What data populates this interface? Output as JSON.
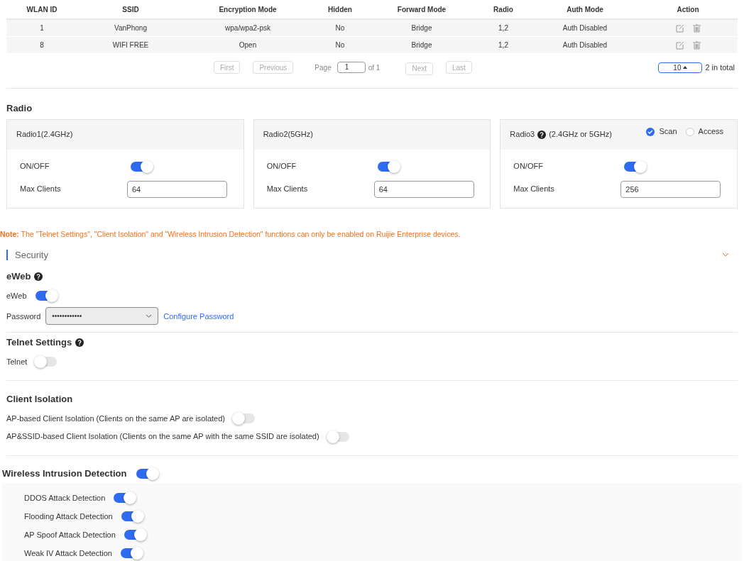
{
  "wlan_table": {
    "columns": [
      "WLAN ID",
      "SSID",
      "Encryption Mode",
      "Hidden",
      "Forward Mode",
      "Radio",
      "Auth Mode",
      "Action"
    ],
    "rows": [
      [
        "1",
        "VanPhong",
        "wpa/wpa2-psk",
        "No",
        "Bridge",
        "1,2",
        "Auth Disabled"
      ],
      [
        "8",
        "WIFI FREE",
        "Open",
        "No",
        "Bridge",
        "1,2",
        "Auth Disabled"
      ]
    ]
  },
  "pagination": {
    "first": "First",
    "previous": "Previous",
    "page_label": "Page",
    "page": "1",
    "of": "of 1",
    "next": "Next",
    "last": "Last",
    "page_size": "10",
    "total": "2 in total"
  },
  "radio": {
    "title": "Radio",
    "cards": [
      {
        "name": "Radio1(2.4GHz)",
        "help": false,
        "onoff_label": "ON/OFF",
        "on": true,
        "max_label": "Max Clients",
        "max_clients": "64"
      },
      {
        "name": "Radio2(5GHz)",
        "help": false,
        "onoff_label": "ON/OFF",
        "on": true,
        "max_label": "Max Clients",
        "max_clients": "64"
      },
      {
        "name": "Radio3",
        "help": true,
        "band": "(2.4GHz or 5GHz)",
        "modes": [
          {
            "label": "Scan",
            "selected": true
          },
          {
            "label": "Access",
            "selected": false
          }
        ],
        "onoff_label": "ON/OFF",
        "on": true,
        "max_label": "Max Clients",
        "max_clients": "256"
      }
    ]
  },
  "note": {
    "prefix": "Note:",
    "text": " The \"Telnet Settings\", \"Client Isolation\" and \"Wireless Intrusion Detection\" functions can only be enabled on Ruijie Enterprise devices."
  },
  "security": {
    "title": "Security",
    "expanded": true
  },
  "eweb": {
    "title": "eWeb",
    "toggle_label": "eWeb",
    "on": true,
    "password_label": "Password",
    "password": "••••••••••••",
    "configure_link": "Configure Password"
  },
  "telnet": {
    "title": "Telnet Settings",
    "toggle_label": "Telnet",
    "on": false
  },
  "client_isolation": {
    "title": "Client Isolation",
    "items": [
      {
        "label": "AP-based Client Isolation (Clients on the same AP are isolated)",
        "on": false
      },
      {
        "label": "AP&SSID-based Client Isolation (Clients on the same AP with the same SSID are isolated)",
        "on": false
      }
    ]
  },
  "wids": {
    "title": "Wireless Intrusion Detection",
    "on": true,
    "items": [
      {
        "label": "DDOS Attack Detection",
        "on": true
      },
      {
        "label": "Flooding Attack Detection",
        "on": true
      },
      {
        "label": "AP Spoof Attack Detection",
        "on": true
      },
      {
        "label": "Weak IV Attack Detection",
        "on": true
      }
    ]
  }
}
